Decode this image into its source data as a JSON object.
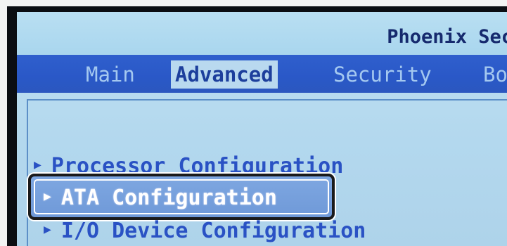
{
  "header": {
    "title": "Phoenix Sec"
  },
  "tabs": [
    {
      "label": "Main"
    },
    {
      "label": "Advanced"
    },
    {
      "label": "Security"
    },
    {
      "label": "Bo"
    }
  ],
  "menu": {
    "items": [
      {
        "label": "Processor Configuration"
      },
      {
        "label": "ATA Configuration"
      },
      {
        "label": "I/O Device Configuration"
      }
    ],
    "selected_index": 1
  },
  "colors": {
    "menu_bar": "#2f5fcd",
    "screen_bg": "#b3d8ee",
    "item_text": "#2a52c4",
    "title_text": "#162a6e"
  },
  "icons": {
    "item_arrow": "right-triangle-arrow"
  }
}
